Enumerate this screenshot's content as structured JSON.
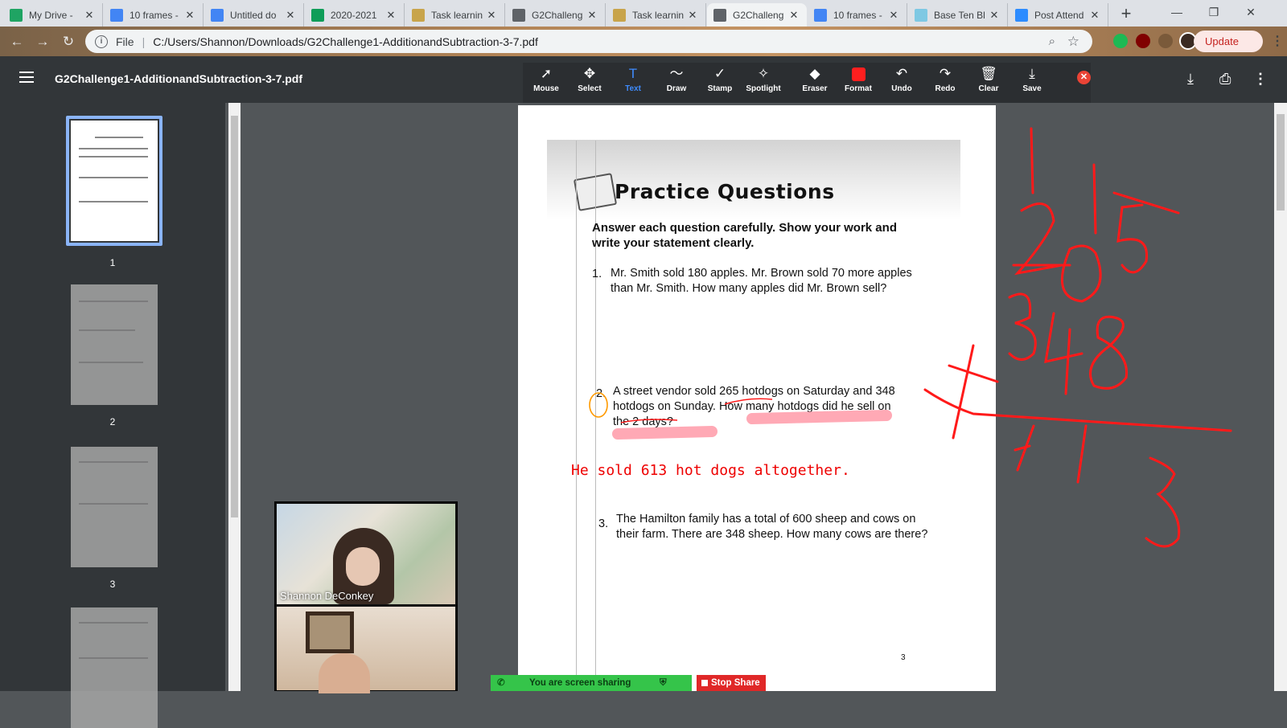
{
  "tabs": [
    {
      "label": "My Drive -",
      "favicon": "drive-icon",
      "color": "#1fa463"
    },
    {
      "label": "10 frames -",
      "favicon": "docs-icon",
      "color": "#4285f4"
    },
    {
      "label": "Untitled do",
      "favicon": "docs-icon",
      "color": "#4285f4"
    },
    {
      "label": "2020-2021",
      "favicon": "sheets-icon",
      "color": "#0f9d58"
    },
    {
      "label": "Task learnin",
      "favicon": "task-icon",
      "color": "#c8a44b"
    },
    {
      "label": "G2Challeng",
      "favicon": "globe-icon",
      "color": "#5f6368"
    },
    {
      "label": "Task learnin",
      "favicon": "task-icon",
      "color": "#c8a44b"
    },
    {
      "label": "G2Challeng",
      "favicon": "globe-icon",
      "color": "#5f6368"
    },
    {
      "label": "10 frames -",
      "favicon": "docs-icon",
      "color": "#4285f4"
    },
    {
      "label": "Base Ten Bl",
      "favicon": "blocks-icon",
      "color": "#7ec8e3"
    },
    {
      "label": "Post Attend",
      "favicon": "zoom-icon",
      "color": "#2d8cff"
    }
  ],
  "address": {
    "scheme": "File",
    "url": "C:/Users/Shannon/Downloads/G2Challenge1-AdditionandSubtraction-3-7.pdf"
  },
  "browser": {
    "update_label": "Update"
  },
  "pdf": {
    "title": "G2Challenge1-AdditionandSubtraction-3-7.pdf",
    "tools": [
      {
        "label": "Mouse",
        "icon": "cursor-icon",
        "glyph": "➚"
      },
      {
        "label": "Select",
        "icon": "move-icon",
        "glyph": "✥"
      },
      {
        "label": "Text",
        "icon": "text-icon",
        "glyph": "T"
      },
      {
        "label": "Draw",
        "icon": "draw-icon",
        "glyph": "〜"
      },
      {
        "label": "Stamp",
        "icon": "check-icon",
        "glyph": "✓"
      },
      {
        "label": "Spotlight",
        "icon": "spotlight-icon",
        "glyph": "✧"
      },
      {
        "label": "Eraser",
        "icon": "eraser-icon",
        "glyph": "◆"
      },
      {
        "label": "Format",
        "icon": "color-swatch-icon",
        "glyph": ""
      },
      {
        "label": "Undo",
        "icon": "undo-icon",
        "glyph": "↶"
      },
      {
        "label": "Redo",
        "icon": "redo-icon",
        "glyph": "↷"
      },
      {
        "label": "Clear",
        "icon": "trash-icon",
        "glyph": "🗑"
      },
      {
        "label": "Save",
        "icon": "save-icon",
        "glyph": "⤓"
      }
    ],
    "selected_tool": "Text",
    "thumbnails": [
      "1",
      "2",
      "3"
    ]
  },
  "document": {
    "heading": "Practice Questions",
    "instructions": "Answer each question carefully. Show your work and write your statement clearly.",
    "q1_num": "1.",
    "q1": "Mr. Smith sold 180 apples. Mr. Brown sold 70 more apples than Mr. Smith. How many apples did Mr. Brown sell?",
    "q2_num": "2.",
    "q2": "A street vendor sold 265 hotdogs on Saturday and 348 hotdogs on Sunday. How many hotdogs did he sell on the 2 days?",
    "q3_num": "3.",
    "q3": "The Hamilton family has a total of 600 sheep and cows on their farm. There are 348 sheep. How many cows are there?",
    "answer_text": "He sold 613 hot dogs altogether.",
    "page_number": "3"
  },
  "meeting": {
    "participant_name": "Shannon DeConkey",
    "sharing_text": "You are screen sharing",
    "stop_share_label": "Stop Share"
  },
  "colors": {
    "ink": "#ff1a1a",
    "highlight": "#ff9aa8",
    "accent": "#3f8cff"
  }
}
